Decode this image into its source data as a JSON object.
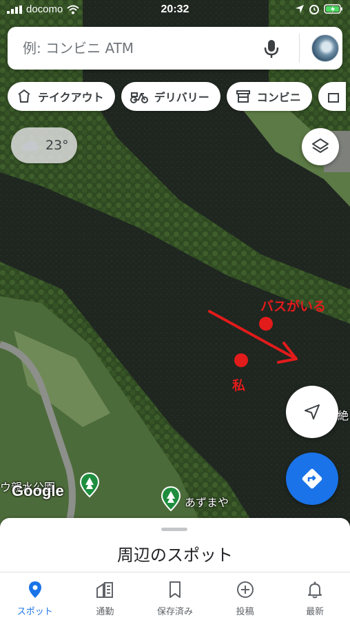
{
  "status_bar": {
    "carrier": "docomo",
    "time": "20:32"
  },
  "search": {
    "placeholder": "例: コンビニ ATM"
  },
  "chips": [
    {
      "label": "テイクアウト",
      "icon": "takeout-icon"
    },
    {
      "label": "デリバリー",
      "icon": "scooter-icon"
    },
    {
      "label": "コンビニ",
      "icon": "store-icon"
    }
  ],
  "weather": {
    "temperature": "23°",
    "icon": "cloud-icon"
  },
  "annotations": {
    "bass_label": "バスがいる",
    "me_label": "私"
  },
  "map_labels": {
    "park_name": "ウ親水公園",
    "gazebo": "あずまや",
    "edge_text": "絶",
    "google_logo": "Google"
  },
  "sheet": {
    "title": "周辺のスポット"
  },
  "nav": {
    "items": [
      {
        "label": "スポット",
        "icon": "pin-icon",
        "active": true
      },
      {
        "label": "通勤",
        "icon": "commute-icon",
        "active": false
      },
      {
        "label": "保存済み",
        "icon": "bookmark-icon",
        "active": false
      },
      {
        "label": "投稿",
        "icon": "add-circle-icon",
        "active": false
      },
      {
        "label": "最新",
        "icon": "bell-icon",
        "active": false
      }
    ]
  },
  "colors": {
    "accent": "#1a73e8",
    "annotation": "#e21b1b"
  }
}
